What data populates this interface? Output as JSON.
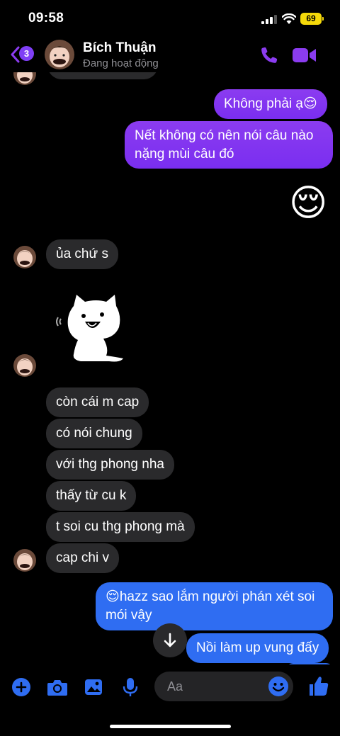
{
  "status_bar": {
    "time": "09:58",
    "battery": "69"
  },
  "header": {
    "back_badge_count": "3",
    "contact_name": "Bích Thuận",
    "presence": "Đang hoạt động"
  },
  "messages": {
    "outgoing": [
      "Không phải ạ😌",
      "Nết không có nên nói câu nào",
      "nặng mùi câu đó",
      "hazz sao lắm người phán xét soi",
      "mói vậy",
      "Nồi làm up vung đấy"
    ],
    "incoming": [
      "ủa chứ s",
      "còn cái m cap",
      "có nói chung",
      "với thg phong nha",
      "thấy từ cu k",
      "t soi cu thg phong mà",
      "cap chi v"
    ],
    "big_emoji": "😌",
    "blue_emoji": "😌"
  },
  "composer": {
    "placeholder": "Aa"
  },
  "colors": {
    "accent_purple": "#8b3cf0",
    "accent_blue": "#2f6df2",
    "bubble_gray": "#2a2a2c"
  },
  "icons": [
    "back-chevron-icon",
    "phone-icon",
    "video-call-icon",
    "plus-icon",
    "camera-icon",
    "gallery-icon",
    "microphone-icon",
    "emoji-icon",
    "thumbs-up-icon",
    "arrow-down-icon",
    "sticker-cat",
    "sound-wave-icon"
  ]
}
